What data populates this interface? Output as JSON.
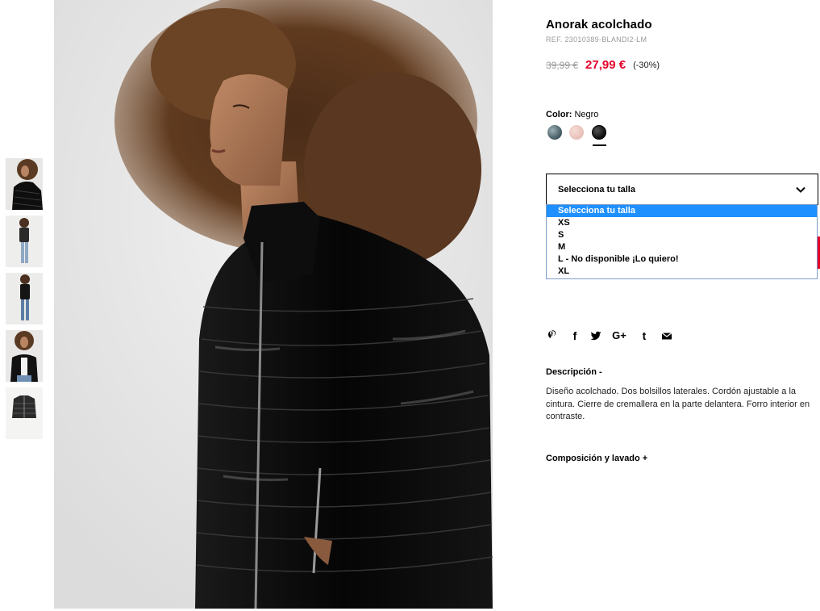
{
  "product": {
    "title": "Anorak acolchado",
    "ref": "REF. 23010389-BLANDI2-LM",
    "old_price": "39,99 €",
    "sale_price": "27,99 €",
    "discount": "(-30%)",
    "color_label": "Color:",
    "color_value": "Negro",
    "swatches": [
      {
        "name": "swatch-teal",
        "color": "#5c7378"
      },
      {
        "name": "swatch-pink",
        "color": "#ebc8c0"
      },
      {
        "name": "swatch-black",
        "color": "#111111",
        "selected": true
      }
    ]
  },
  "size": {
    "select_value": "Selecciona tu talla",
    "options": [
      "Selecciona tu talla",
      "XS",
      "S",
      "M",
      "L - No disponible ¡Lo quiero!",
      "XL"
    ],
    "selected_index": 0
  },
  "share": {
    "icons": [
      "pinterest-icon",
      "facebook-icon",
      "twitter-icon",
      "googleplus-icon",
      "tumblr-icon",
      "email-icon"
    ],
    "googleplus_text": "G+",
    "tumblr_text": "t",
    "facebook_text": "f"
  },
  "description": {
    "title": "Descripción -",
    "text": "Diseño acolchado. Dos bolsillos laterales. Cordón ajustable a la cintura. Cierre de cremallera en la parte delantera. Forro interior en contraste."
  },
  "composition": {
    "title": "Composición y lavado +"
  },
  "colors": {
    "accent_red": "#e4002b",
    "dropdown_highlight": "#1e90ff",
    "muted_text": "#9a9a9a"
  }
}
